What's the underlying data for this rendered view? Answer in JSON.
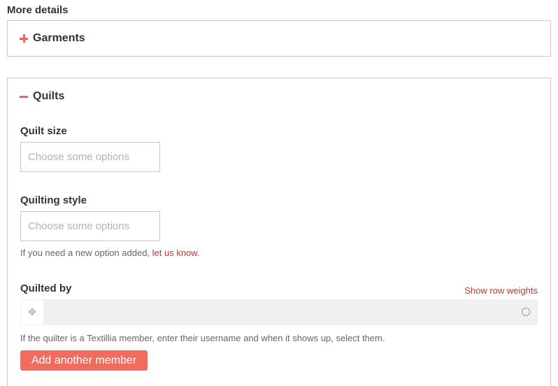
{
  "section_title": "More details",
  "panels": {
    "garments": {
      "label": "Garments",
      "toggle": "plus-icon"
    },
    "quilts": {
      "label": "Quilts",
      "toggle": "minus-icon"
    }
  },
  "quilt_size": {
    "label": "Quilt size",
    "placeholder": "Choose some options"
  },
  "quilting_style": {
    "label": "Quilting style",
    "placeholder": "Choose some options",
    "help_text": "If you need a new option added, ",
    "help_link": "let us know."
  },
  "quilted_by": {
    "label": "Quilted by",
    "row_weights_link": "Show row weights",
    "drag_icon": "move-icon",
    "member_value": "",
    "help_text": "If the quilter is a Textillia member, enter their username and when it shows up, select them.",
    "add_button": "Add another member"
  },
  "colors": {
    "accent": "#e8655a",
    "link": "#c0392b",
    "button": "#f06c5f"
  }
}
